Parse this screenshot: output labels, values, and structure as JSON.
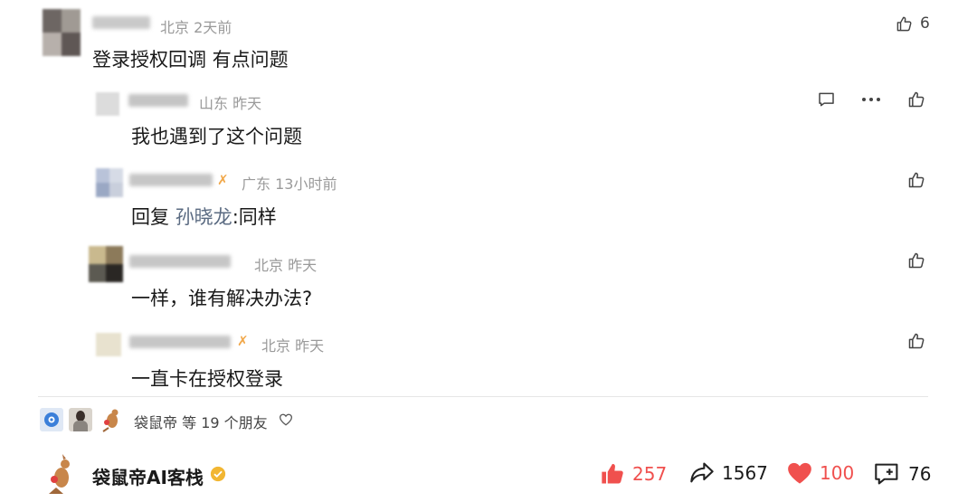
{
  "comments": [
    {
      "location": "北京",
      "time": "2天前",
      "text": "登录授权回调 有点问题",
      "likes": "6"
    },
    {
      "location": "山东",
      "time": "昨天",
      "text": "我也遇到了这个问题"
    },
    {
      "location": "广东",
      "time": "13小时前",
      "reply_prefix": "回复",
      "reply_to": "孙晓龙",
      "colon": ":",
      "text": "同样"
    },
    {
      "location": "北京",
      "time": "昨天",
      "text": "一样，谁有解决办法?"
    },
    {
      "location": "北京",
      "time": "昨天",
      "text": "一直卡在授权登录"
    }
  ],
  "liked_by": {
    "name": "袋鼠帝",
    "rest": "等 19 个朋友"
  },
  "footer": {
    "account": "袋鼠帝AI客栈",
    "likes": "257",
    "shares": "1567",
    "hearts": "100",
    "comments": "76"
  },
  "colors": {
    "accent_red": "#f0504e",
    "muted": "#9a9a9a",
    "mention": "#5b6b82",
    "verified": "#f2b632"
  }
}
